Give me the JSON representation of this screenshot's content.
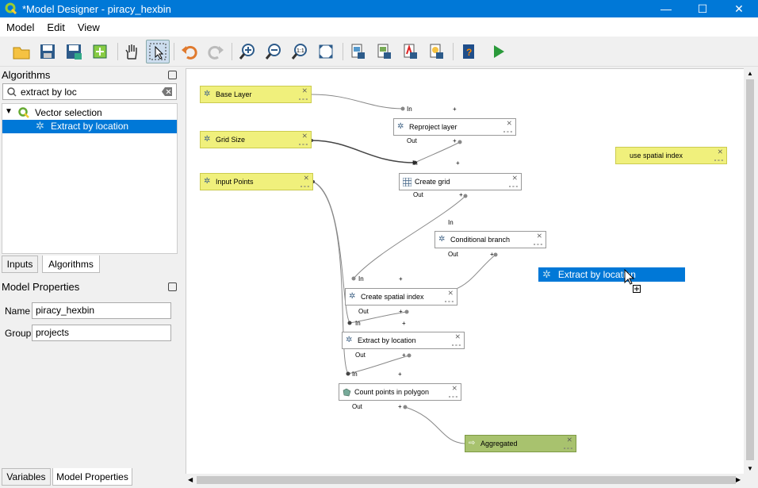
{
  "window": {
    "title": "*Model Designer - piracy_hexbin",
    "minimize": "—",
    "maximize": "☐",
    "close": "✕"
  },
  "menu": [
    "Model",
    "Edit",
    "View"
  ],
  "left": {
    "algorithms_header": "Algorithms",
    "search_value": "extract by loc",
    "tree": {
      "group": "Vector selection",
      "item": "Extract by location"
    },
    "tabs": [
      "Inputs",
      "Algorithms"
    ],
    "model_properties_header": "Model Properties",
    "name_label": "Name",
    "name_value": "piracy_hexbin",
    "group_label": "Group",
    "group_value": "projects",
    "bottom_tabs": [
      "Variables",
      "Model Properties"
    ]
  },
  "canvas": {
    "inputs": [
      "Base Layer",
      "Grid Size",
      "Input Points",
      "use spatial index"
    ],
    "algorithms": [
      "Reproject layer",
      "Create grid",
      "Conditional branch",
      "Create spatial index",
      "Extract by location",
      "Count points in polygon"
    ],
    "output": "Aggregated",
    "port_in": "In",
    "port_out": "Out",
    "plus": "+",
    "drag_label": "Extract by location"
  },
  "colors": {
    "accent": "#0078d7",
    "input_node": "#f0f07c",
    "output_node": "#a8c26e"
  }
}
